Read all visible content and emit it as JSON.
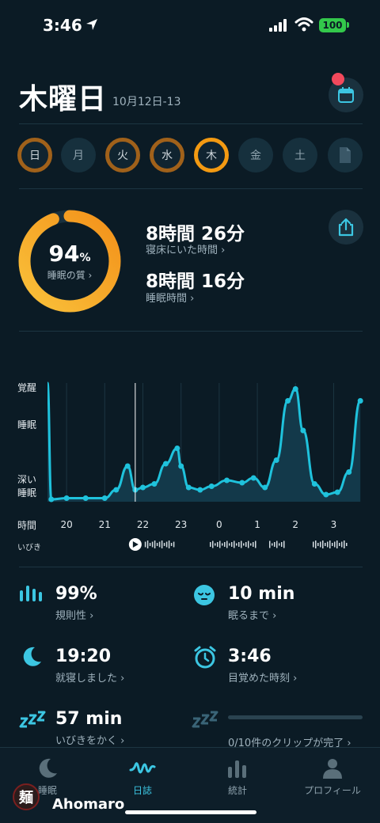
{
  "status_bar": {
    "time": "3:46",
    "battery": "100"
  },
  "header": {
    "day": "木曜日",
    "date_range": "10月12日-13"
  },
  "week_days": [
    {
      "label": "日",
      "state": "done"
    },
    {
      "label": "月",
      "state": "future"
    },
    {
      "label": "火",
      "state": "done"
    },
    {
      "label": "水",
      "state": "done"
    },
    {
      "label": "木",
      "state": "today"
    },
    {
      "label": "金",
      "state": "future"
    },
    {
      "label": "土",
      "state": "future"
    }
  ],
  "summary": {
    "quality_value": "94",
    "quality_unit": "%",
    "quality_fraction": 0.94,
    "quality_label": "睡眠の質 ›",
    "time_in_bed": "8時間 26分",
    "time_in_bed_label": "寝床にいた時間 ›",
    "sleep_time": "8時間 16分",
    "sleep_time_label": "睡眠時間 ›"
  },
  "chart": {
    "y_labels": {
      "awake": "覚醒",
      "sleep": "睡眠",
      "deep": "深い\n睡眠",
      "time": "時間"
    },
    "x_labels": [
      "20",
      "21",
      "22",
      "23",
      "0",
      "1",
      "2",
      "3"
    ],
    "snore_label": "いびき"
  },
  "chart_data": {
    "type": "area",
    "x_unit": "hour",
    "x": [
      19.5,
      19.6,
      20.0,
      20.5,
      21.0,
      21.3,
      21.6,
      21.8,
      22.0,
      22.3,
      22.6,
      22.9,
      23.0,
      23.2,
      23.5,
      23.8,
      24.2,
      24.6,
      24.9,
      25.2,
      25.5,
      25.8,
      26.0,
      26.2,
      26.5,
      26.8,
      27.1,
      27.4,
      27.7
    ],
    "values": [
      1.0,
      0.02,
      0.03,
      0.03,
      0.03,
      0.1,
      0.3,
      0.1,
      0.12,
      0.15,
      0.32,
      0.45,
      0.3,
      0.12,
      0.1,
      0.13,
      0.18,
      0.16,
      0.2,
      0.12,
      0.35,
      0.85,
      0.95,
      0.6,
      0.15,
      0.06,
      0.08,
      0.25,
      0.85
    ],
    "y_levels": [
      "深い睡眠",
      "睡眠",
      "覚醒"
    ],
    "xlim": [
      19.5,
      27.8
    ],
    "grid": true,
    "accent": "#1fc2dc"
  },
  "stats": [
    {
      "value": "99%",
      "label": "規則性 ›",
      "icon": "bars-icon"
    },
    {
      "value": "10 min",
      "label": "眠るまで ›",
      "icon": "sleepy-face-icon"
    },
    {
      "value": "19:20",
      "label": "就寝しました ›",
      "icon": "moon-icon"
    },
    {
      "value": "3:46",
      "label": "目覚めた時刻 ›",
      "icon": "alarm-icon"
    },
    {
      "value": "57 min",
      "label": "いびきをかく ›",
      "icon": "zzz-icon"
    },
    {
      "value": "",
      "label": "0/10件のクリップが完了 ›",
      "icon": "zzz-icon"
    }
  ],
  "nav": [
    {
      "label": "睡眠",
      "icon": "moon-icon"
    },
    {
      "label": "日誌",
      "icon": "pulse-icon",
      "active": true
    },
    {
      "label": "統計",
      "icon": "stats-icon"
    },
    {
      "label": "プロフィール",
      "icon": "profile-icon"
    }
  ],
  "watermark": {
    "name": "Ahomaro",
    "logo_text": "麺"
  },
  "colors": {
    "background": "#0b1b25",
    "accent": "#3cc6e2",
    "ring_start": "#f8b531",
    "ring_end": "#f39a12"
  }
}
